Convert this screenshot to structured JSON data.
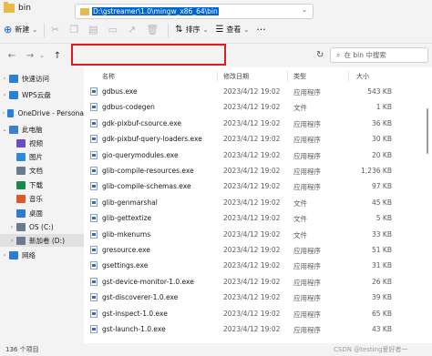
{
  "window": {
    "title": "bin"
  },
  "commandbar": {
    "new_label": "新建",
    "sort_label": "排序",
    "view_label": "查看"
  },
  "address": {
    "path": "D:\\gstreamer\\1.0\\mingw_x86_64\\bin",
    "search_placeholder": "在 bin 中搜索"
  },
  "navpane": {
    "items": [
      {
        "label": "快速访问",
        "icon": "star-icon",
        "color": "#2a7fd6"
      },
      {
        "label": "WPS云盘",
        "icon": "cloud-icon",
        "color": "#2a7fd6"
      },
      {
        "label": "OneDrive - Persona",
        "icon": "cloud-icon",
        "color": "#2a7fd6"
      },
      {
        "label": "此电脑",
        "icon": "computer-icon",
        "color": "#3b7fd1"
      },
      {
        "label": "视频",
        "icon": "video-icon",
        "color": "#6a4bc4"
      },
      {
        "label": "图片",
        "icon": "picture-icon",
        "color": "#2e8bd6"
      },
      {
        "label": "文档",
        "icon": "document-icon",
        "color": "#6b7a8f"
      },
      {
        "label": "下载",
        "icon": "download-icon",
        "color": "#1a8a4a"
      },
      {
        "label": "音乐",
        "icon": "music-icon",
        "color": "#e0582a"
      },
      {
        "label": "桌面",
        "icon": "desktop-icon",
        "color": "#2e7bcf"
      },
      {
        "label": "OS (C:)",
        "icon": "drive-icon",
        "color": "#6b7a8f"
      },
      {
        "label": "新加卷 (D:)",
        "icon": "drive-icon",
        "color": "#6b7a8f"
      },
      {
        "label": "网络",
        "icon": "network-icon",
        "color": "#2e7bcf"
      }
    ]
  },
  "columns": {
    "name": "名称",
    "date": "修改日期",
    "type": "类型",
    "size": "大小"
  },
  "files": [
    {
      "name": "gdbus.exe",
      "date": "2023/4/12 19:02",
      "type": "应用程序",
      "size": "543 KB"
    },
    {
      "name": "gdbus-codegen",
      "date": "2023/4/12 19:02",
      "type": "文件",
      "size": "1 KB"
    },
    {
      "name": "gdk-pixbuf-csource.exe",
      "date": "2023/4/12 19:02",
      "type": "应用程序",
      "size": "36 KB"
    },
    {
      "name": "gdk-pixbuf-query-loaders.exe",
      "date": "2023/4/12 19:02",
      "type": "应用程序",
      "size": "30 KB"
    },
    {
      "name": "gio-querymodules.exe",
      "date": "2023/4/12 19:02",
      "type": "应用程序",
      "size": "20 KB"
    },
    {
      "name": "glib-compile-resources.exe",
      "date": "2023/4/12 19:02",
      "type": "应用程序",
      "size": "1,236 KB"
    },
    {
      "name": "glib-compile-schemas.exe",
      "date": "2023/4/12 19:02",
      "type": "应用程序",
      "size": "97 KB"
    },
    {
      "name": "glib-genmarshal",
      "date": "2023/4/12 19:02",
      "type": "文件",
      "size": "45 KB"
    },
    {
      "name": "glib-gettextize",
      "date": "2023/4/12 19:02",
      "type": "文件",
      "size": "5 KB"
    },
    {
      "name": "glib-mkenums",
      "date": "2023/4/12 19:02",
      "type": "文件",
      "size": "33 KB"
    },
    {
      "name": "gresource.exe",
      "date": "2023/4/12 19:02",
      "type": "应用程序",
      "size": "51 KB"
    },
    {
      "name": "gsettings.exe",
      "date": "2023/4/12 19:02",
      "type": "应用程序",
      "size": "31 KB"
    },
    {
      "name": "gst-device-monitor-1.0.exe",
      "date": "2023/4/12 19:02",
      "type": "应用程序",
      "size": "26 KB"
    },
    {
      "name": "gst-discoverer-1.0.exe",
      "date": "2023/4/12 19:02",
      "type": "应用程序",
      "size": "39 KB"
    },
    {
      "name": "gst-inspect-1.0.exe",
      "date": "2023/4/12 19:02",
      "type": "应用程序",
      "size": "65 KB"
    },
    {
      "name": "gst-launch-1.0.exe",
      "date": "2023/4/12 19:02",
      "type": "应用程序",
      "size": "43 KB"
    }
  ],
  "status": {
    "count": "136 个项目",
    "watermark": "CSDN @testing爱好者一"
  }
}
